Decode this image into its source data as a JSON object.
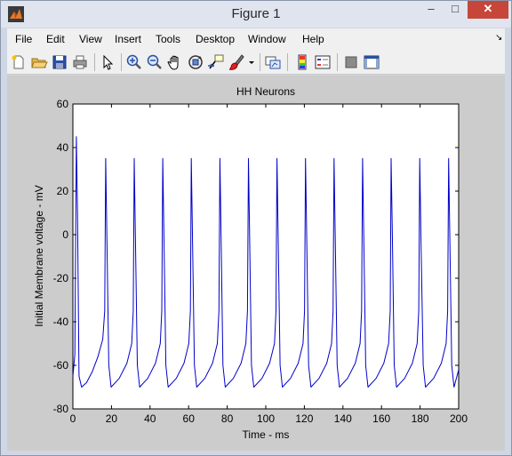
{
  "window": {
    "title": "Figure 1",
    "minimize": "–",
    "maximize": "□",
    "close": "✕"
  },
  "menu": [
    "File",
    "Edit",
    "View",
    "Insert",
    "Tools",
    "Desktop",
    "Window",
    "Help"
  ],
  "dock_arrow": "↘",
  "toolbar": {
    "icons": [
      "new-figure-icon",
      "open-file-icon",
      "save-icon",
      "print-icon",
      "edit-plot-icon",
      "zoom-in-icon",
      "zoom-out-icon",
      "pan-icon",
      "rotate-3d-icon",
      "data-cursor-icon",
      "brush-icon",
      "brush-dropdown-icon",
      "link-plot-icon",
      "insert-colorbar-icon",
      "insert-legend-icon",
      "hide-plot-tools-icon",
      "show-plot-tools-icon"
    ]
  },
  "colors": {
    "trace": "#0000c8",
    "figure_bg": "#cccccc",
    "axes_bg": "#ffffff"
  },
  "chart_data": {
    "type": "line",
    "title": "HH Neurons",
    "xlabel": "Time - ms",
    "ylabel": "Initial Membrane voltage - mV",
    "xlim": [
      0,
      200
    ],
    "ylim": [
      -80,
      60
    ],
    "xticks": [
      "0",
      "20",
      "40",
      "60",
      "80",
      "100",
      "120",
      "140",
      "160",
      "180",
      "200"
    ],
    "yticks": [
      "60",
      "40",
      "20",
      "0",
      "-20",
      "-40",
      "-60",
      "-80"
    ],
    "grid": false,
    "series": [
      {
        "x": [
          0,
          1.0,
          1.8,
          2.4,
          3.2,
          4.5,
          7,
          10,
          13,
          15.5,
          16.5,
          17.0,
          17.6,
          18.6,
          19.8,
          24,
          28,
          30.5,
          31.3,
          31.8,
          32.4,
          33.4,
          34.6,
          38.8,
          42.8,
          45.3,
          46.1,
          46.6,
          47.2,
          48.2,
          49.4,
          53.6,
          57.6,
          60.1,
          60.9,
          61.4,
          62.0,
          63.0,
          64.2,
          68.4,
          72.4,
          74.9,
          75.7,
          76.2,
          76.8,
          77.8,
          79.0,
          83.2,
          87.2,
          89.7,
          90.5,
          91.0,
          91.6,
          92.6,
          93.8,
          98.0,
          102.0,
          104.5,
          105.3,
          105.8,
          106.4,
          107.4,
          108.6,
          112.8,
          116.8,
          119.3,
          120.1,
          120.6,
          121.2,
          122.2,
          123.4,
          127.6,
          131.6,
          134.1,
          134.9,
          135.4,
          136.0,
          137.0,
          138.2,
          142.4,
          146.4,
          148.9,
          149.7,
          150.2,
          150.8,
          151.8,
          153.0,
          157.2,
          161.2,
          163.7,
          164.5,
          165.0,
          165.6,
          166.6,
          167.8,
          172.0,
          176.0,
          178.5,
          179.3,
          179.8,
          180.4,
          181.6,
          182.8,
          187.0,
          191.0,
          193.5,
          194.3,
          194.8,
          195.4,
          196.4,
          197.6,
          200
        ],
        "y": [
          -65,
          -55,
          45,
          10,
          -65,
          -70,
          -68,
          -63,
          -56,
          -48,
          -35,
          35,
          0,
          -60,
          -70,
          -66,
          -59,
          -50,
          -35,
          35,
          0,
          -60,
          -70,
          -66,
          -59,
          -50,
          -35,
          35,
          0,
          -60,
          -70,
          -66,
          -59,
          -50,
          -35,
          35,
          0,
          -60,
          -70,
          -66,
          -59,
          -50,
          -35,
          35,
          0,
          -60,
          -70,
          -66,
          -59,
          -50,
          -35,
          35,
          0,
          -60,
          -70,
          -66,
          -59,
          -50,
          -35,
          35,
          0,
          -60,
          -70,
          -66,
          -59,
          -50,
          -35,
          35,
          0,
          -60,
          -70,
          -66,
          -59,
          -50,
          -35,
          35,
          0,
          -60,
          -70,
          -66,
          -59,
          -50,
          -35,
          35,
          0,
          -60,
          -70,
          -66,
          -59,
          -50,
          -35,
          35,
          0,
          -60,
          -70,
          -66,
          -59,
          -50,
          -35,
          35,
          0,
          -60,
          -70,
          -66,
          -59,
          -50,
          -35,
          35,
          0,
          -60,
          -70,
          -62
        ]
      }
    ]
  }
}
